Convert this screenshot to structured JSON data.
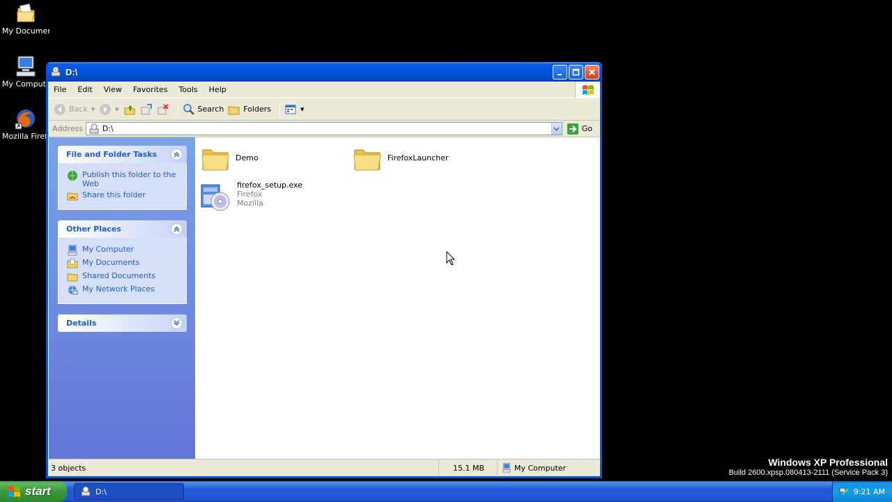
{
  "desktop": {
    "icons": [
      {
        "label": "My Documents",
        "icon": "folder-documents-icon"
      },
      {
        "label": "My Computer",
        "icon": "computer-icon"
      },
      {
        "label": "Mozilla Firefox",
        "icon": "firefox-icon"
      }
    ]
  },
  "window": {
    "title": "D:\\",
    "menu": [
      "File",
      "Edit",
      "View",
      "Favorites",
      "Tools",
      "Help"
    ],
    "toolbar": {
      "back_label": "Back",
      "search_label": "Search",
      "folders_label": "Folders"
    },
    "address": {
      "label": "Address",
      "value": "D:\\",
      "go_label": "Go"
    },
    "taskpane": {
      "file_tasks": {
        "title": "File and Folder Tasks",
        "items": [
          "Publish this folder to the Web",
          "Share this folder"
        ]
      },
      "other_places": {
        "title": "Other Places",
        "items": [
          "My Computer",
          "My Documents",
          "Shared Documents",
          "My Network Places"
        ]
      },
      "details": {
        "title": "Details"
      }
    },
    "files": [
      {
        "name": "Demo",
        "type": "folder"
      },
      {
        "name": "FirefoxLauncher",
        "type": "folder"
      },
      {
        "name": "firefox_setup.exe",
        "type": "installer",
        "line2": "Firefox",
        "line3": "Mozilla"
      }
    ],
    "status": {
      "objects": "3 objects",
      "size": "15.1 MB",
      "location": "My Computer"
    }
  },
  "taskbar": {
    "start_label": "start",
    "active_task": "D:\\",
    "clock": "9:21 AM"
  },
  "branding": {
    "line1": "Windows XP Professional",
    "line2": "Build 2600.xpsp.080413-2111 (Service Pack 3)"
  }
}
